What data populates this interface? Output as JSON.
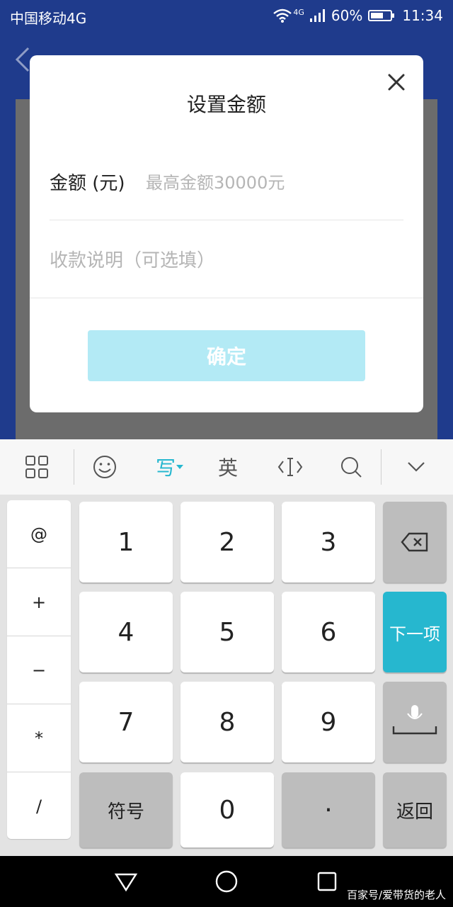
{
  "status_bar": {
    "carrier": "中国移动4G",
    "network": "4G",
    "battery": "60%",
    "time": "11:34"
  },
  "modal": {
    "title": "设置金额",
    "amount_label": "金额 (元)",
    "amount_placeholder": "最高金额30000元",
    "description_placeholder": "收款说明（可选填）",
    "confirm_label": "确定"
  },
  "keyboard": {
    "toolbar": {
      "write_label": "写",
      "english_label": "英"
    },
    "side_keys": [
      "@",
      "+",
      "−",
      "*",
      "/"
    ],
    "digits": [
      "1",
      "2",
      "3",
      "4",
      "5",
      "6",
      "7",
      "8",
      "9",
      "0"
    ],
    "symbol_label": "符号",
    "dot_label": "·",
    "next_label": "下一项",
    "return_label": "返回"
  },
  "watermark": "百家号/爱带货的老人",
  "colors": {
    "background_blue": "#1f3b8c",
    "confirm_disabled": "#b3eaf5",
    "next_key": "#26b7cf"
  }
}
